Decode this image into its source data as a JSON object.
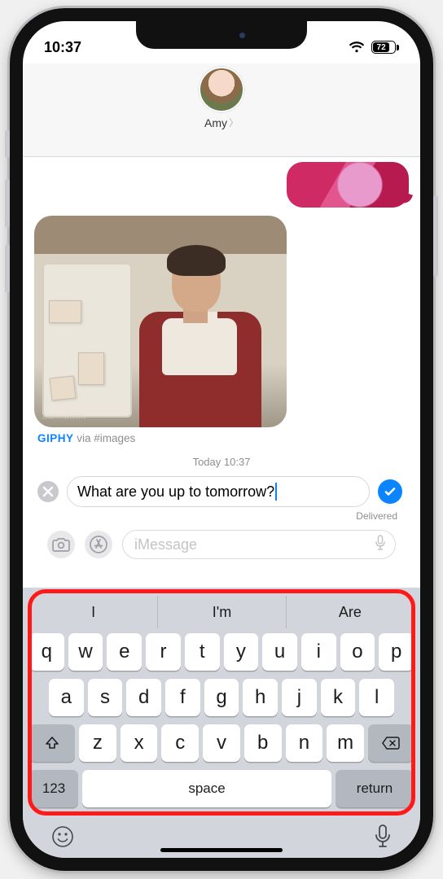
{
  "status": {
    "time": "10:37",
    "battery_text": "72"
  },
  "header": {
    "contact_name": "Amy"
  },
  "conversation": {
    "gif_attrib_brand": "GIPHY",
    "gif_attrib_rest": " via #images",
    "gif_signature": "butination",
    "timestamp": "Today 10:37",
    "editing_text": "What are you up to tomorrow?",
    "delivered_label": "Delivered"
  },
  "compose": {
    "placeholder": "iMessage"
  },
  "keyboard": {
    "suggestions": [
      "I",
      "I'm",
      "Are"
    ],
    "row1": [
      "q",
      "w",
      "e",
      "r",
      "t",
      "y",
      "u",
      "i",
      "o",
      "p"
    ],
    "row2": [
      "a",
      "s",
      "d",
      "f",
      "g",
      "h",
      "j",
      "k",
      "l"
    ],
    "row3": [
      "z",
      "x",
      "c",
      "v",
      "b",
      "n",
      "m"
    ],
    "sym_label": "123",
    "space_label": "space",
    "return_label": "return"
  }
}
